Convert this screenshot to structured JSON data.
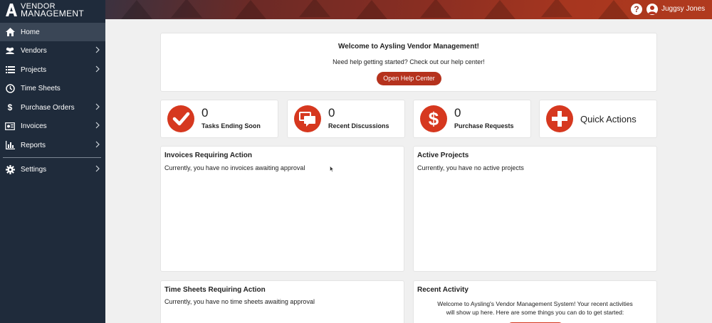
{
  "brand": {
    "line1": "VENDOR",
    "line2": "MANAGEMENT",
    "icon": "aysling-a-logo"
  },
  "header": {
    "help_label": "?",
    "user_name": "Juggsy Jones"
  },
  "sidebar": {
    "items": [
      {
        "label": "Home",
        "icon": "home-icon"
      },
      {
        "label": "Vendors",
        "icon": "users-icon"
      },
      {
        "label": "Projects",
        "icon": "list-icon"
      },
      {
        "label": "Time Sheets",
        "icon": "clock-icon"
      },
      {
        "label": "Purchase Orders",
        "icon": "dollar-icon"
      },
      {
        "label": "Invoices",
        "icon": "invoice-icon"
      },
      {
        "label": "Reports",
        "icon": "bar-chart-icon"
      },
      {
        "label": "Settings",
        "icon": "gear-icon"
      }
    ]
  },
  "welcome": {
    "title": "Welcome to Aysling Vendor Management!",
    "subtitle": "Need help getting started? Check out our help center!",
    "button_label": "Open Help Center"
  },
  "stats": [
    {
      "count": "0",
      "label": "Tasks Ending Soon",
      "icon": "check-icon"
    },
    {
      "count": "0",
      "label": "Recent Discussions",
      "icon": "chat-icon"
    },
    {
      "count": "0",
      "label": "Purchase Requests",
      "icon": "dollar-icon"
    }
  ],
  "quick_actions": {
    "label": "Quick Actions",
    "icon": "plus-icon"
  },
  "panels": {
    "invoices": {
      "title": "Invoices Requiring Action",
      "text": "Currently, you have no invoices awaiting approval"
    },
    "projects": {
      "title": "Active Projects",
      "text": "Currently, you have no active projects"
    },
    "timesheets": {
      "title": "Time Sheets Requiring Action",
      "text": "Currently, you have no time sheets awaiting approval"
    },
    "activity": {
      "title": "Recent Activity",
      "text": "Welcome to Aysling's Vendor Management System! Your recent activities will show up here. Here are some things you can do to get started:"
    }
  },
  "colors": {
    "accent": "#d6381f",
    "sidebar": "#1f2b3b",
    "sidebar_active": "#3a4656"
  }
}
